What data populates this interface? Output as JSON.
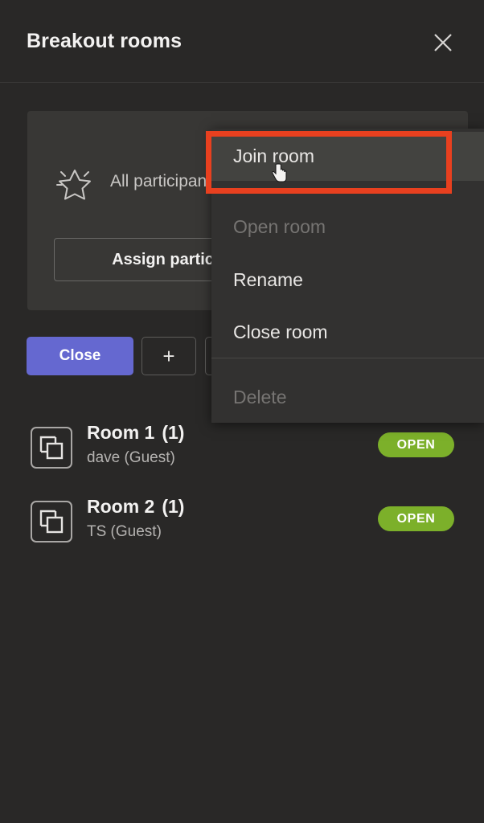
{
  "header": {
    "title": "Breakout rooms",
    "close_icon": "close-icon"
  },
  "all_participants_card": {
    "icon": "sparkle-star-icon",
    "label": "All participants",
    "assign_button_label": "Assign participants"
  },
  "actions": {
    "close_label": "Close",
    "add_label": "+",
    "more_label": "···"
  },
  "rooms": [
    {
      "icon": "breakout-room-icon",
      "name": "Room 1",
      "count": "(1)",
      "members": "dave (Guest)",
      "status": "OPEN"
    },
    {
      "icon": "breakout-room-icon",
      "name": "Room 2",
      "count": "(1)",
      "members": "TS (Guest)",
      "status": "OPEN"
    }
  ],
  "context_menu": {
    "items": [
      {
        "label": "Join room",
        "state": "hovered"
      },
      {
        "label": "Open room",
        "state": "disabled"
      },
      {
        "label": "Rename",
        "state": "normal"
      },
      {
        "label": "Close room",
        "state": "normal"
      },
      {
        "label": "Delete",
        "state": "disabled"
      }
    ]
  },
  "annotation": {
    "target": "Join room",
    "color": "#e8401f"
  },
  "colors": {
    "background": "#292827",
    "card": "#383735",
    "menu": "#323130",
    "menu_hover": "#434340",
    "accent_purple": "#6568d0",
    "status_green": "#7cb02a",
    "annotation_red": "#e8401f"
  }
}
